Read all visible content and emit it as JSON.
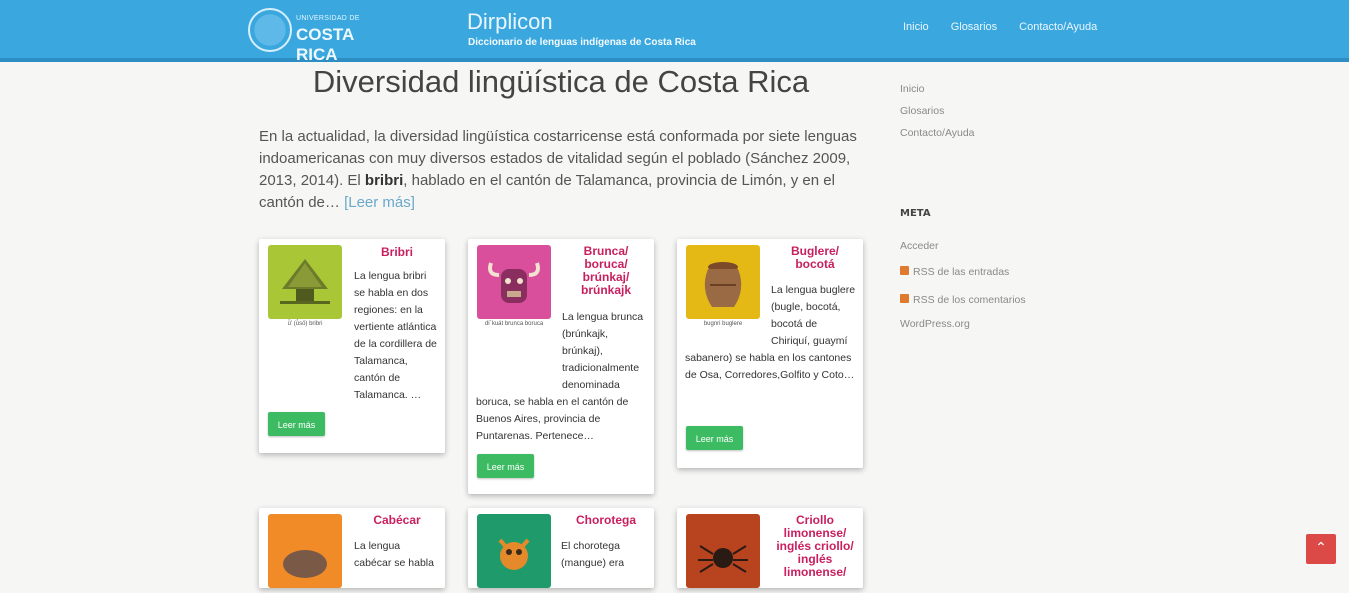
{
  "header": {
    "logo_small": "UNIVERSIDAD DE",
    "logo_big": "COSTA RICA",
    "site_title": "Dirplicon",
    "site_tagline": "Diccionario de lenguas indígenas de Costa Rica",
    "nav": [
      "Inicio",
      "Glosarios",
      "Contacto/Ayuda"
    ]
  },
  "main": {
    "title": "Diversidad lingüística de Costa Rica",
    "intro_before": "En la actualidad, la diversidad lingüística costarricense está conformada por siete lenguas indoamericanas con muy diversos estados de vitalidad según el poblado (Sánchez 2009, 2013, 2014). El ",
    "intro_bold": "bribri",
    "intro_after": ", hablado en el cantón de Talamanca, provincia de Limón, y en el cantón de… ",
    "intro_more": "[Leer más]"
  },
  "cards": [
    {
      "title": "Bribri",
      "caption": "ù̀' (ù̀sö) bribri",
      "desc": "La lengua bribri se habla en dos regiones: en la vertiente atlántica de la cordillera de Talamanca, cantón de Talamanca, …",
      "button": "Leer más",
      "color": "#a8c636"
    },
    {
      "title": "Brunca/ boruca/ brúnkaj/ brúnkajk",
      "caption": "dí´kuát brunca boruca",
      "desc": "La lengua brunca (brúnkajk, brúnkaj), tradicionalmente denominada boruca, se habla en el cantón de Buenos Aires, provincia de Puntarenas. Pertenece…",
      "button": "Leer más",
      "color": "#d94f9b"
    },
    {
      "title": "Buglere/ bocotá",
      "caption": "bugnri buglere",
      "desc": "La lengua buglere (bugle, bocotá, bocotá de Chiriquí, guaymí sabanero) se habla en los cantones de Osa, Corredores,Golfito y Coto…",
      "button": "Leer más",
      "color": "#e5b915"
    },
    {
      "title": "Cabécar",
      "caption": "",
      "desc": "La lengua cabécar se habla",
      "button": "",
      "color": "#f08b28"
    },
    {
      "title": "Chorotega",
      "caption": "",
      "desc": "El chorotega (mangue) era",
      "button": "",
      "color": "#1f9a6b"
    },
    {
      "title": "Criollo limonense/ inglés criollo/ inglés limonense/",
      "caption": "",
      "desc": "",
      "button": "",
      "color": "#b8431f"
    }
  ],
  "sidebar": {
    "links": [
      "Inicio",
      "Glosarios",
      "Contacto/Ayuda"
    ],
    "meta_title": "META",
    "meta_links": [
      "Acceder",
      "RSS de las entradas",
      "RSS de los comentarios",
      "WordPress.org"
    ]
  },
  "scroll_top": "⌃"
}
